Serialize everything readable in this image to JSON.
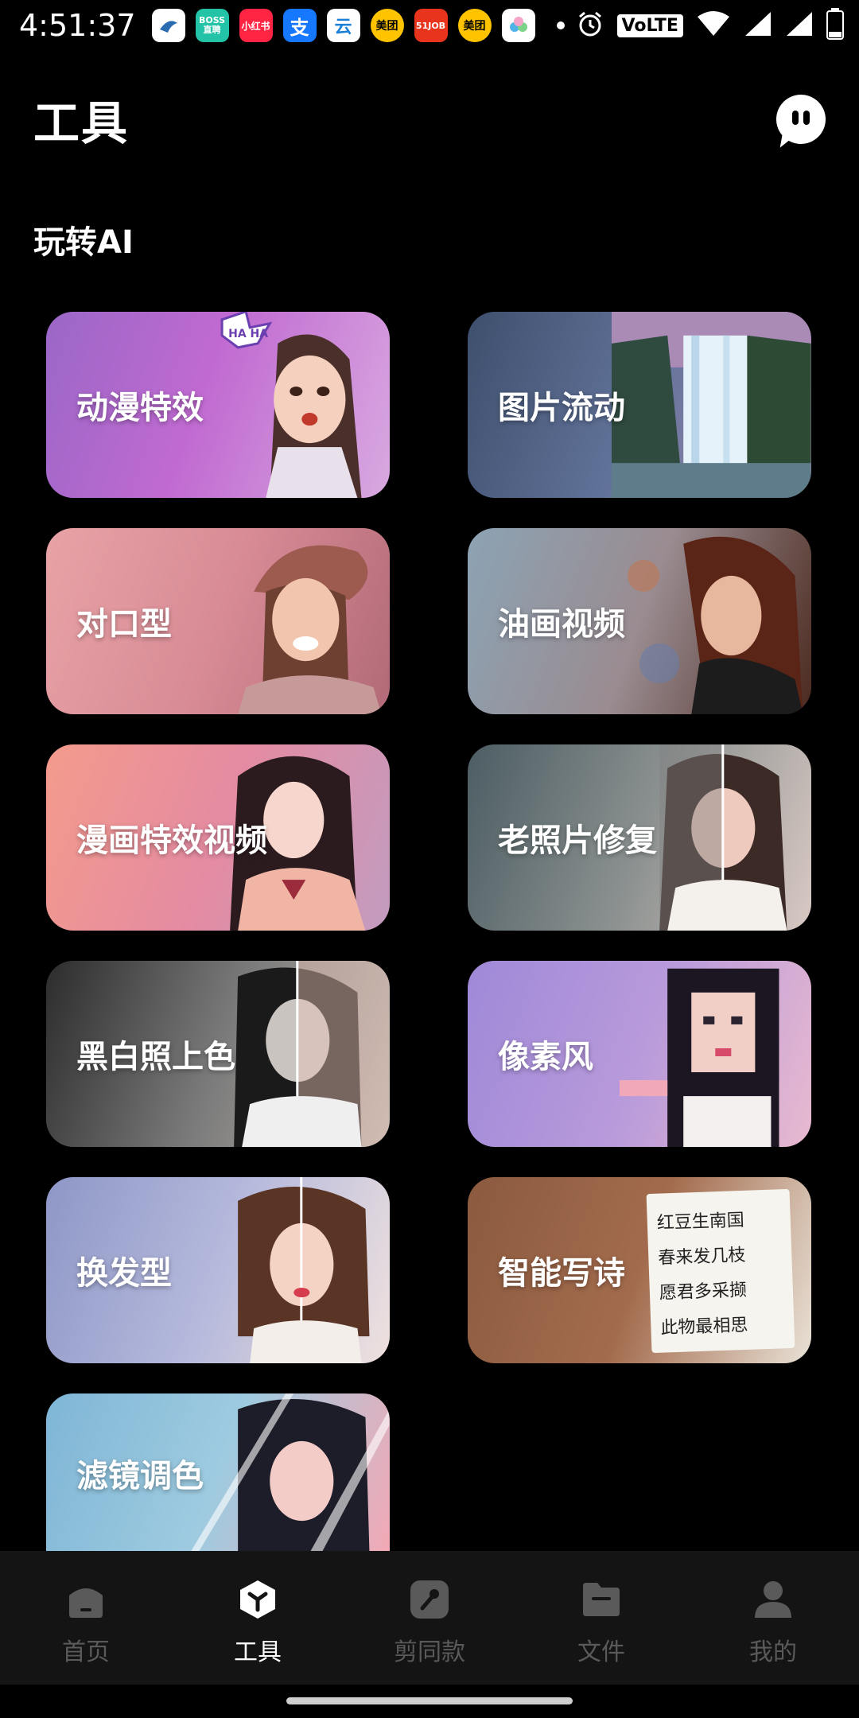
{
  "status_bar": {
    "time": "4:51:37",
    "apps": [
      {
        "icon": "shark-app-icon",
        "text": "",
        "color": "#ffffff"
      },
      {
        "icon": "boss-zhipin-icon",
        "text": "BOSS\n直聘",
        "color": "#22c3a6"
      },
      {
        "icon": "xiaohongshu-icon",
        "text": "小红书",
        "color": "#ff2442"
      },
      {
        "icon": "alipay-icon",
        "text": "支",
        "color": "#1677ff"
      },
      {
        "icon": "yunshanfu-icon",
        "text": "云",
        "color": "#ffffff"
      },
      {
        "icon": "meituan-icon",
        "text": "美团",
        "color": "#ffc300"
      },
      {
        "icon": "51job-icon",
        "text": "51JOB",
        "color": "#e8341c"
      },
      {
        "icon": "meituan-icon",
        "text": "美团",
        "color": "#ffc300"
      },
      {
        "icon": "cloud-app-icon",
        "text": "",
        "color": "#ffffff"
      }
    ],
    "volte": "VoLTE"
  },
  "header": {
    "title": "工具",
    "chat_icon": "chat-bubble-icon"
  },
  "section": {
    "title": "玩转AI"
  },
  "tools": [
    {
      "label": "动漫特效",
      "theme": "anime"
    },
    {
      "label": "图片流动",
      "theme": "waterfall"
    },
    {
      "label": "对口型",
      "theme": "lipsync"
    },
    {
      "label": "油画视频",
      "theme": "oilpaint"
    },
    {
      "label": "漫画特效视频",
      "theme": "comic"
    },
    {
      "label": "老照片修复",
      "theme": "restore"
    },
    {
      "label": "黑白照上色",
      "theme": "colorize"
    },
    {
      "label": "像素风",
      "theme": "pixel"
    },
    {
      "label": "换发型",
      "theme": "hairstyle"
    },
    {
      "label": "智能写诗",
      "theme": "poem",
      "poem_lines": [
        "红豆生南国",
        "春来发几枝",
        "愿君多采撷",
        "此物最相思"
      ]
    },
    {
      "label": "滤镜调色",
      "theme": "filter"
    }
  ],
  "bottom_nav": [
    {
      "label": "首页",
      "icon": "home-icon",
      "active": false
    },
    {
      "label": "工具",
      "icon": "tools-cube-icon",
      "active": true
    },
    {
      "label": "剪同款",
      "icon": "template-icon",
      "active": false
    },
    {
      "label": "文件",
      "icon": "folder-icon",
      "active": false
    },
    {
      "label": "我的",
      "icon": "profile-icon",
      "active": false
    }
  ],
  "colors": {
    "background": "#000000",
    "nav_background": "#141414",
    "nav_active": "#ffffff",
    "nav_inactive": "#5a5a5a"
  }
}
